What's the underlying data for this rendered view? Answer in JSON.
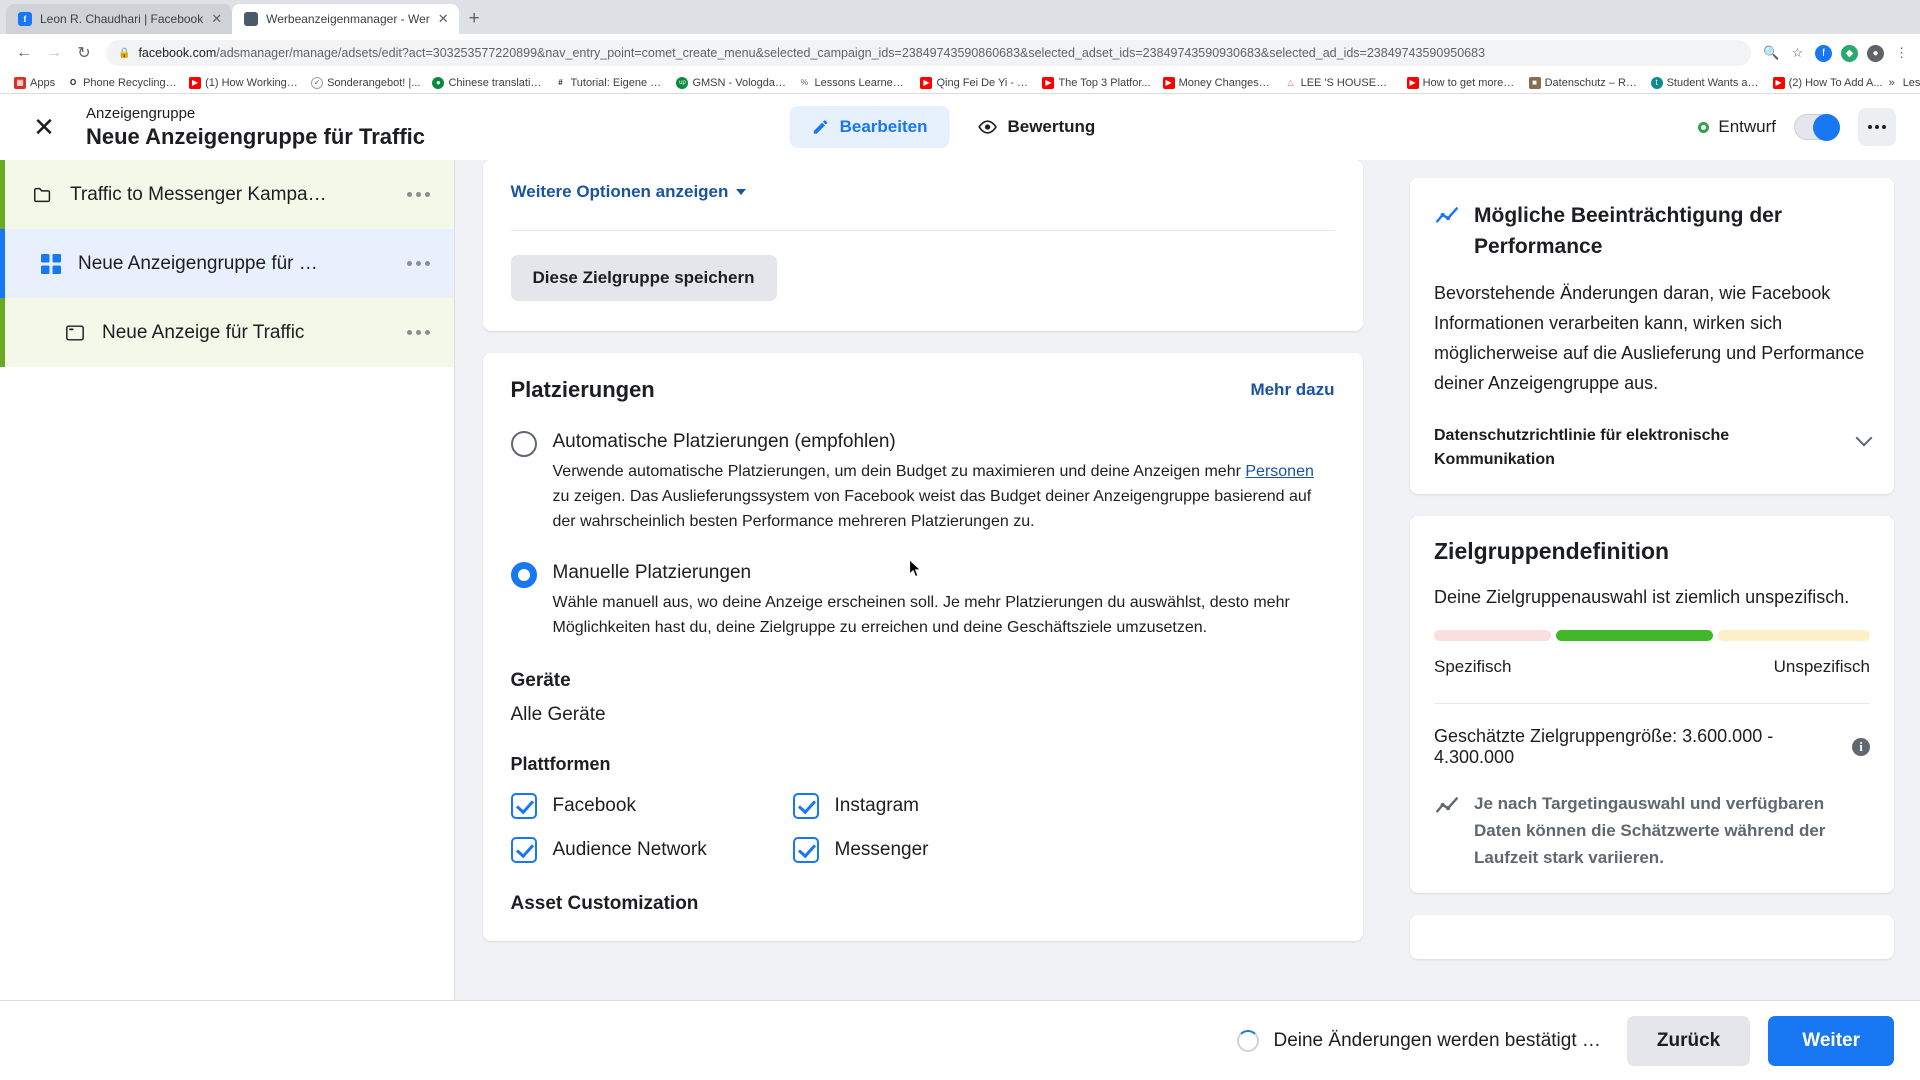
{
  "browser": {
    "tabs": [
      {
        "title": "Leon R. Chaudhari | Facebook",
        "favicon": "facebook-icon",
        "active": false,
        "close": "✕"
      },
      {
        "title": "Werbeanzeigenmanager - Wer",
        "favicon": "adsmanager-icon",
        "active": true,
        "close": "✕"
      }
    ],
    "new_tab_label": "+",
    "nav": {
      "back": "←",
      "forward": "→",
      "reload": "↻",
      "lock": "🔒"
    },
    "url_domain": "facebook.com",
    "url_path": "/adsmanager/manage/adsets/edit?act=303253577220899&nav_entry_point=comet_create_menu&selected_campaign_ids=23849743590860683&selected_adset_ids=23849743590930683&selected_ad_ids=23849743590950683",
    "extension_icons": [
      "zoom-icon",
      "bookmark-star-icon",
      "facebook-ext-icon",
      "puzzle-ext-icon",
      "profile-icon",
      "chrome-menu-icon"
    ],
    "bookmarks": [
      {
        "label": "Apps",
        "icon": "apps-grid-icon",
        "color": "#d93025"
      },
      {
        "label": "Phone Recycling,...",
        "icon": "o2-icon",
        "color": "#ffffff"
      },
      {
        "label": "(1) How Working a...",
        "icon": "youtube-icon",
        "color": "#ff0000"
      },
      {
        "label": "Sonderangebot! |...",
        "icon": "generic-icon",
        "color": "#ffffff"
      },
      {
        "label": "Chinese translatio...",
        "icon": "green-circle-icon",
        "color": "#0a8a3c"
      },
      {
        "label": "Tutorial: Eigene Fa...",
        "icon": "hash-icon",
        "color": "#ffffff"
      },
      {
        "label": "GMSN - Vologda,...",
        "icon": "up-icon",
        "color": "#0a8a3c"
      },
      {
        "label": "Lessons Learned f...",
        "icon": "percent-icon",
        "color": "#ffffff"
      },
      {
        "label": "Qing Fei De Yi - Y...",
        "icon": "youtube-icon",
        "color": "#ff0000"
      },
      {
        "label": "The Top 3 Platfor...",
        "icon": "youtube-icon",
        "color": "#ff0000"
      },
      {
        "label": "Money Changes E...",
        "icon": "youtube-icon",
        "color": "#ff0000"
      },
      {
        "label": "LEE 'S HOUSE—...",
        "icon": "airbnb-icon",
        "color": "#ffffff"
      },
      {
        "label": "How to get more v...",
        "icon": "youtube-icon",
        "color": "#ff0000"
      },
      {
        "label": "Datenschutz – Re...",
        "icon": "photo-icon",
        "color": "#8a6c52"
      },
      {
        "label": "Student Wants an...",
        "icon": "teal-circle-icon",
        "color": "#0d8b8b"
      },
      {
        "label": "(2) How To Add A...",
        "icon": "youtube-icon",
        "color": "#ff0000"
      }
    ],
    "reading_list_label": "Leseliste",
    "bookmarks_overflow": "»"
  },
  "header": {
    "close_label": "✕",
    "eyebrow": "Anzeigengruppe",
    "title": "Neue Anzeigengruppe für Traffic",
    "tabs": [
      {
        "label": "Bearbeiten",
        "icon": "pencil-icon",
        "active": true
      },
      {
        "label": "Bewertung",
        "icon": "eye-icon",
        "active": false
      }
    ],
    "status_label": "Entwurf",
    "status_color": "#31a24c",
    "toggle_on": true,
    "toggle_color": "#1877f2",
    "more_label": "⋯"
  },
  "sidebar": {
    "items": [
      {
        "label": "Traffic to Messenger Kampa…",
        "icon": "folder-icon",
        "level": 1,
        "state": "campaign",
        "rail_color": "#6aaa22",
        "menu": "⋯"
      },
      {
        "label": "Neue Anzeigengruppe für …",
        "icon": "adset-grid-icon",
        "level": 2,
        "state": "adset",
        "rail_color": "#1877f2",
        "menu": "⋯"
      },
      {
        "label": "Neue Anzeige für Traffic",
        "icon": "ad-window-icon",
        "level": 3,
        "state": "ad",
        "rail_color": "#6aaa22",
        "menu": "⋯"
      }
    ]
  },
  "main": {
    "top_card": {
      "more_options_label": "Weitere Optionen anzeigen",
      "save_audience_label": "Diese Zielgruppe speichern"
    },
    "placements": {
      "title": "Platzierungen",
      "learn_more": "Mehr dazu",
      "options": [
        {
          "label": "Automatische Platzierungen (empfohlen)",
          "selected": false,
          "desc_before": "Verwende automatische Platzierungen, um dein Budget zu maximieren und deine Anzeigen mehr ",
          "desc_link": "Personen",
          "desc_after": " zu zeigen. Das Auslieferungssystem von Facebook weist das Budget deiner Anzeigengruppe basierend auf der wahrscheinlich besten Performance mehreren Platzierungen zu."
        },
        {
          "label": "Manuelle Platzierungen",
          "selected": true,
          "desc_before": "Wähle manuell aus, wo deine Anzeige erscheinen soll. Je mehr Platzierungen du auswählst, desto mehr Möglichkeiten hast du, deine Zielgruppe zu erreichen und deine Geschäftsziele umzusetzen.",
          "desc_link": "",
          "desc_after": ""
        }
      ],
      "devices_title": "Geräte",
      "devices_value": "Alle Geräte",
      "platforms_title": "Plattformen",
      "platforms": [
        {
          "label": "Facebook",
          "checked": true
        },
        {
          "label": "Instagram",
          "checked": true
        },
        {
          "label": "Audience Network",
          "checked": true
        },
        {
          "label": "Messenger",
          "checked": true
        }
      ],
      "asset_customization_title": "Asset Customization"
    }
  },
  "right_panel": {
    "performance_card": {
      "icon": "chart-line-icon",
      "title": "Mögliche Beeinträchtigung der Performance",
      "body": "Bevorstehende Änderungen daran, wie Facebook Informationen verarbeiten kann, wirken sich möglicherweise auf die Auslieferung und Performance deiner Anzeigengruppe aus.",
      "footer_label": "Datenschutzrichtlinie für elektronische Kommunikation",
      "footer_icon": "chevron-down-icon"
    },
    "audience_card": {
      "title": "Zielgruppendefinition",
      "subtitle": "Deine Zielgruppenauswahl ist ziemlich unspezifisch.",
      "meter": {
        "segments": [
          {
            "name": "low",
            "color": "#fadfe0",
            "flex": 1
          },
          {
            "name": "active",
            "color": "#42b72a",
            "flex": 1.35
          },
          {
            "name": "high",
            "color": "#fdf0c8",
            "flex": 1.3
          }
        ],
        "left_label": "Spezifisch",
        "right_label": "Unspezifisch"
      },
      "estimate_label": "Geschätzte Zielgruppengröße: 3.600.000 - 4.300.000",
      "estimate_info": "i",
      "note_icon": "chart-line-icon",
      "note": "Je nach Targetingauswahl und verfügbaren Daten können die Schätzwerte während der Laufzeit stark variieren."
    }
  },
  "footer": {
    "saving_text": "Deine Änderungen werden bestätigt …",
    "back_label": "Zurück",
    "next_label": "Weiter"
  }
}
